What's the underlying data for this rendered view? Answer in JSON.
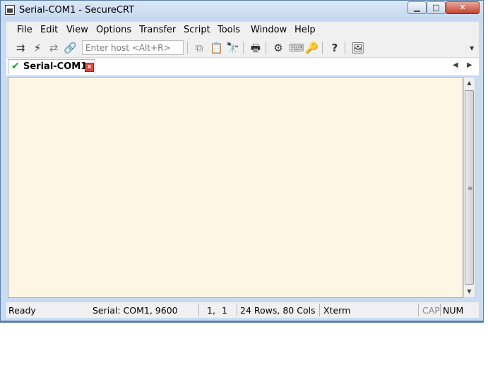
{
  "window": {
    "title": "Serial-COM1 - SecureCRT",
    "minimize_glyph": "▁",
    "maximize_glyph": "□",
    "close_glyph": "✕"
  },
  "menu": {
    "items": [
      "File",
      "Edit",
      "View",
      "Options",
      "Transfer",
      "Script",
      "Tools",
      "Window",
      "Help"
    ]
  },
  "toolbar": {
    "host_placeholder": "Enter host <Alt+R>",
    "icons": [
      "connect-icon",
      "quick-connect-icon",
      "reconnect-icon",
      "disconnect-icon",
      "copy-icon",
      "paste-icon",
      "find-icon",
      "print-icon",
      "settings-icon",
      "keymap-icon",
      "key-icon",
      "help-icon",
      "options-icon"
    ]
  },
  "tabs": [
    {
      "label": "Serial-COM1",
      "connected": true
    }
  ],
  "status": {
    "ready": "Ready",
    "connection": "Serial: COM1, 9600",
    "row": "1,",
    "col": "1",
    "size": "24 Rows, 80 Cols",
    "terminal": "Xterm",
    "cap": "CAP",
    "num": "NUM"
  },
  "colors": {
    "terminal_bg": "#fdf6e4",
    "connected_check": "#1a9b1a",
    "tab_close": "#d84b3a"
  }
}
